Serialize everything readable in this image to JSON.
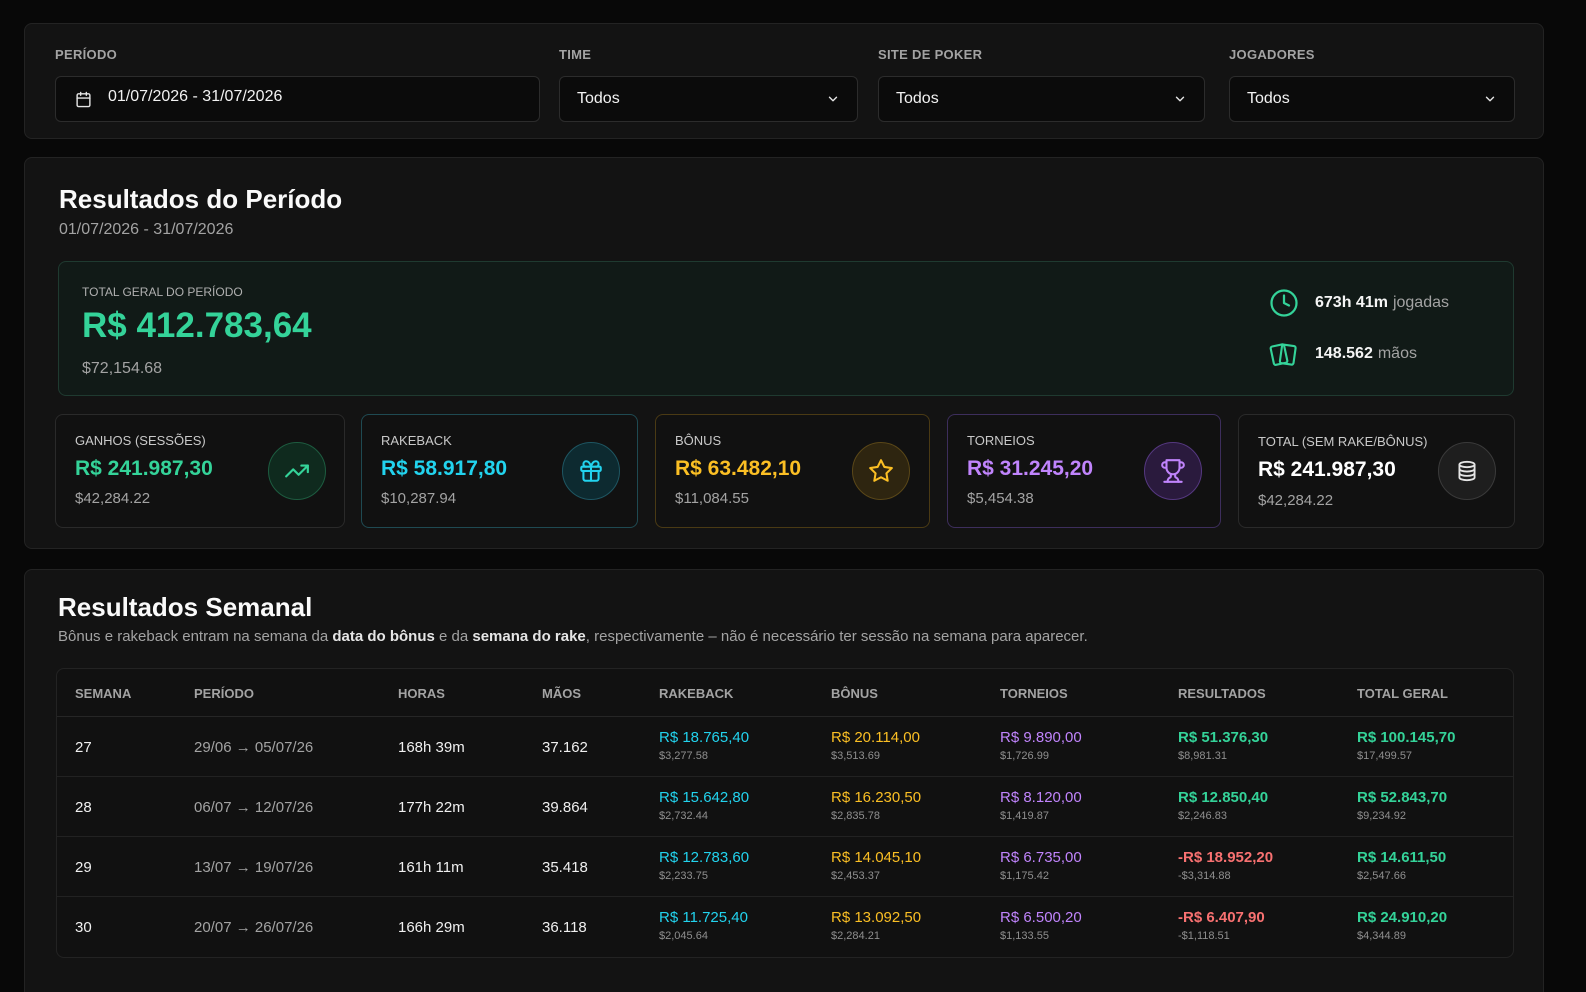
{
  "filters": {
    "period": {
      "label": "PERÍODO",
      "value": "01/07/2026 - 31/07/2026"
    },
    "team": {
      "label": "TIME",
      "value": "Todos"
    },
    "site": {
      "label": "SITE DE POKER",
      "value": "Todos"
    },
    "players": {
      "label": "JOGADORES",
      "value": "Todos"
    }
  },
  "period_results": {
    "title": "Resultados do Período",
    "range": "01/07/2026 - 31/07/2026",
    "total": {
      "label": "TOTAL GERAL DO PERÍODO",
      "value": "R$ 412.783,64",
      "usd": "$72,154.68"
    },
    "hours": {
      "value": "673h 41m",
      "unit": "jogadas"
    },
    "hands": {
      "value": "148.562",
      "unit": "mãos"
    },
    "cards": [
      {
        "label": "GANHOS (SESSÕES)",
        "value": "R$ 241.987,30",
        "usd": "$42,284.22",
        "icon": "trending-up-icon",
        "color": "#34d399"
      },
      {
        "label": "RAKEBACK",
        "value": "R$ 58.917,80",
        "usd": "$10,287.94",
        "icon": "gift-icon",
        "color": "#22d3ee"
      },
      {
        "label": "BÔNUS",
        "value": "R$ 63.482,10",
        "usd": "$11,084.55",
        "icon": "star-icon",
        "color": "#fbbf24"
      },
      {
        "label": "TORNEIOS",
        "value": "R$ 31.245,20",
        "usd": "$5,454.38",
        "icon": "trophy-icon",
        "color": "#c084fc"
      },
      {
        "label": "TOTAL (SEM RAKE/BÔNUS)",
        "value": "R$ 241.987,30",
        "usd": "$42,284.22",
        "icon": "coins-icon",
        "color": "#ffffff"
      }
    ]
  },
  "weekly": {
    "title": "Resultados Semanal",
    "desc_1": "Bônus e rakeback entram na semana da ",
    "desc_b1": "data do bônus",
    "desc_2": " e da ",
    "desc_b2": "semana do rake",
    "desc_3": ", respectivamente – não é necessário ter sessão na semana para aparecer.",
    "columns": [
      "SEMANA",
      "PERÍODO",
      "HORAS",
      "MÃOS",
      "RAKEBACK",
      "BÔNUS",
      "TORNEIOS",
      "RESULTADOS",
      "TOTAL GERAL"
    ],
    "rows": [
      {
        "week": "27",
        "period": "29/06 → 05/07/26",
        "hours": "168h 39m",
        "hands": "37.162",
        "rakeback": "R$ 18.765,40",
        "rakeback_usd": "$3,277.58",
        "bonus": "R$ 20.114,00",
        "bonus_usd": "$3,513.69",
        "tournaments": "R$ 9.890,00",
        "tournaments_usd": "$1,726.99",
        "results": "R$ 51.376,30",
        "results_usd": "$8,981.31",
        "total": "R$ 100.145,70",
        "total_usd": "$17,499.57"
      },
      {
        "week": "28",
        "period": "06/07 → 12/07/26",
        "hours": "177h 22m",
        "hands": "39.864",
        "rakeback": "R$ 15.642,80",
        "rakeback_usd": "$2,732.44",
        "bonus": "R$ 16.230,50",
        "bonus_usd": "$2,835.78",
        "tournaments": "R$ 8.120,00",
        "tournaments_usd": "$1,419.87",
        "results": "R$ 12.850,40",
        "results_usd": "$2,246.83",
        "total": "R$ 52.843,70",
        "total_usd": "$9,234.92"
      },
      {
        "week": "29",
        "period": "13/07 → 19/07/26",
        "hours": "161h 11m",
        "hands": "35.418",
        "rakeback": "R$ 12.783,60",
        "rakeback_usd": "$2,233.75",
        "bonus": "R$ 14.045,10",
        "bonus_usd": "$2,453.37",
        "tournaments": "R$ 6.735,00",
        "tournaments_usd": "$1,175.42",
        "results": "-R$ 18.952,20",
        "results_usd": "-$3,314.88",
        "total": "R$ 14.611,50",
        "total_usd": "$2,547.66"
      },
      {
        "week": "30",
        "period": "20/07 → 26/07/26",
        "hours": "166h 29m",
        "hands": "36.118",
        "rakeback": "R$ 11.725,40",
        "rakeback_usd": "$2,045.64",
        "bonus": "R$ 13.092,50",
        "bonus_usd": "$2,284.21",
        "tournaments": "R$ 6.500,20",
        "tournaments_usd": "$1,133.55",
        "results": "-R$ 6.407,90",
        "results_usd": "-$1,118.51",
        "total": "R$ 24.910,20",
        "total_usd": "$4,344.89"
      }
    ]
  },
  "colors": {
    "green": "#34d399",
    "cyan": "#22d3ee",
    "amber": "#fbbf24",
    "purple": "#c084fc",
    "red": "#f87171"
  }
}
